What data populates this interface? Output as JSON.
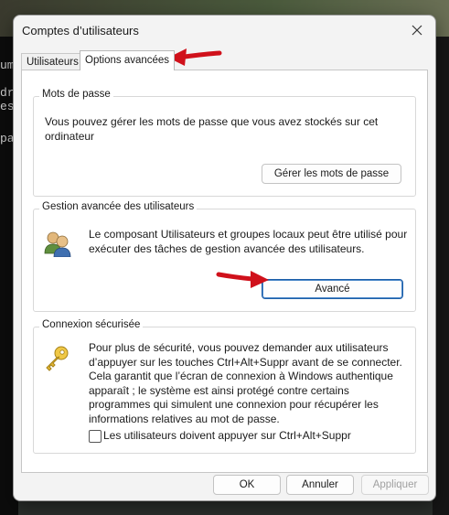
{
  "window": {
    "title": "Comptes d’utilisateurs"
  },
  "background": {
    "terminal_fragments": [
      "um",
      "dr",
      "es",
      "pa"
    ]
  },
  "tabs": [
    {
      "label": "Utilisateurs",
      "selected": false
    },
    {
      "label": "Options avancées",
      "selected": true
    }
  ],
  "passwords": {
    "group_label": "Mots de passe",
    "description": "Vous pouvez gérer les mots de passe que vous avez stockés sur cet ordinateur",
    "manage_button": "Gérer les mots de passe"
  },
  "advanced_user_mgmt": {
    "group_label": "Gestion avancée des utilisateurs",
    "description": "Le composant Utilisateurs et groupes locaux peut être utilisé pour exécuter des tâches de gestion avancée des utilisateurs.",
    "advanced_button": "Avancé",
    "icon": "users-group-icon"
  },
  "secure_logon": {
    "group_label": "Connexion sécurisée",
    "description": "Pour plus de sécurité, vous pouvez demander aux utilisateurs d’appuyer sur les touches Ctrl+Alt+Suppr avant de se connecter. Cela garantit que l’écran de connexion à Windows authentique apparaît ; le système est ainsi protégé contre certains programmes qui simulent une connexion pour récupérer les informations relatives au mot de passe.",
    "checkbox_label": "Les utilisateurs doivent appuyer sur Ctrl+Alt+Suppr",
    "checkbox_checked": false,
    "icon": "key-icon"
  },
  "footer": {
    "ok": "OK",
    "cancel": "Annuler",
    "apply": "Appliquer",
    "apply_disabled": true
  },
  "colors": {
    "annotation_arrow": "#d0111b",
    "focus_border": "#1d5fa8"
  }
}
